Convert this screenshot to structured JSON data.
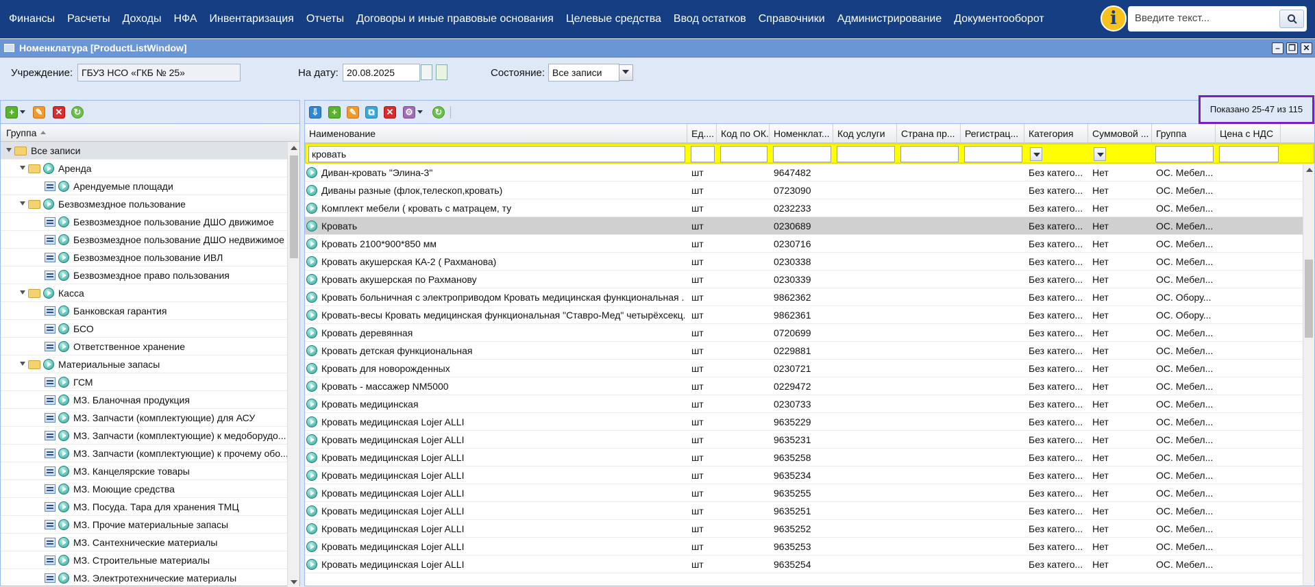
{
  "menu": [
    "Финансы",
    "Расчеты",
    "Доходы",
    "НФА",
    "Инвентаризация",
    "Отчеты",
    "Договоры и иные правовые основания",
    "Целевые средства",
    "Ввод остатков",
    "Справочники",
    "Администрирование",
    "Документооборот"
  ],
  "search": {
    "placeholder": "Введите текст..."
  },
  "window": {
    "title": "Номенклатура [ProductListWindow]"
  },
  "filters": {
    "institution_label": "Учреждение:",
    "institution_value": "ГБУЗ НСО «ГКБ № 25»",
    "date_label": "На дату:",
    "date_value": "20.08.2025",
    "state_label": "Состояние:",
    "state_value": "Все записи"
  },
  "tree": {
    "header": "Группа",
    "nodes": [
      {
        "label": "Все записи",
        "level": 0,
        "type": "folder",
        "selected": true
      },
      {
        "label": "Аренда",
        "level": 1,
        "type": "folder"
      },
      {
        "label": "Арендуемые площади",
        "level": 2,
        "type": "leaf"
      },
      {
        "label": "Безвозмездное пользование",
        "level": 1,
        "type": "folder"
      },
      {
        "label": "Безвозмездное пользование ДШО движимое",
        "level": 2,
        "type": "leaf"
      },
      {
        "label": "Безвозмездное пользование ДШО недвижимое",
        "level": 2,
        "type": "leaf"
      },
      {
        "label": "Безвозмездное пользование ИВЛ",
        "level": 2,
        "type": "leaf"
      },
      {
        "label": "Безвозмездное право пользования",
        "level": 2,
        "type": "leaf"
      },
      {
        "label": "Касса",
        "level": 1,
        "type": "folder"
      },
      {
        "label": "Банковская гарантия",
        "level": 2,
        "type": "leaf"
      },
      {
        "label": "БСО",
        "level": 2,
        "type": "leaf"
      },
      {
        "label": "Ответственное хранение",
        "level": 2,
        "type": "leaf"
      },
      {
        "label": "Материальные запасы",
        "level": 1,
        "type": "folder"
      },
      {
        "label": "ГСМ",
        "level": 2,
        "type": "leaf"
      },
      {
        "label": "МЗ. Бланочная продукция",
        "level": 2,
        "type": "leaf"
      },
      {
        "label": "МЗ. Запчасти (комплектующие) для АСУ",
        "level": 2,
        "type": "leaf"
      },
      {
        "label": "МЗ. Запчасти (комплектующие) к медоборудо...",
        "level": 2,
        "type": "leaf"
      },
      {
        "label": "МЗ. Запчасти (комплектующие) к прочему обо...",
        "level": 2,
        "type": "leaf"
      },
      {
        "label": "МЗ. Канцелярские товары",
        "level": 2,
        "type": "leaf"
      },
      {
        "label": "МЗ. Моющие средства",
        "level": 2,
        "type": "leaf"
      },
      {
        "label": "МЗ. Посуда. Тара для хранения ТМЦ",
        "level": 2,
        "type": "leaf"
      },
      {
        "label": "МЗ. Прочие материальные запасы",
        "level": 2,
        "type": "leaf"
      },
      {
        "label": "МЗ. Сантехнические материалы",
        "level": 2,
        "type": "leaf"
      },
      {
        "label": "МЗ. Строительные материалы",
        "level": 2,
        "type": "leaf"
      },
      {
        "label": "МЗ. Электротехнические материалы",
        "level": 2,
        "type": "leaf"
      }
    ]
  },
  "grid": {
    "shown": "Показано 25-47 из 115",
    "columns": [
      "Наименование",
      "Ед....",
      "Код по ОК...",
      "Номенклат...",
      "Код услуги",
      "Страна пр...",
      "Регистрац...",
      "Категория",
      "Суммовой ...",
      "Группа",
      "Цена с НДС"
    ],
    "filter_name": "кровать",
    "rows": [
      {
        "name": "Диван-кровать \"Элина-3\"",
        "unit": "шт",
        "nom": "9647482",
        "cat": "Без катего...",
        "sum": "Нет",
        "group": "ОС. Мебел..."
      },
      {
        "name": "Диваны разные (флок,телескоп,кровать)",
        "unit": "шт",
        "nom": "0723090",
        "cat": "Без катего...",
        "sum": "Нет",
        "group": "ОС. Мебел..."
      },
      {
        "name": "Комплект мебели ( кровать с матрацем, ту",
        "unit": "шт",
        "nom": "0232233",
        "cat": "Без катего...",
        "sum": "Нет",
        "group": "ОС. Мебел..."
      },
      {
        "name": "Кровать",
        "unit": "шт",
        "nom": "0230689",
        "cat": "Без катего...",
        "sum": "Нет",
        "group": "ОС. Мебел...",
        "selected": true
      },
      {
        "name": "Кровать 2100*900*850 мм",
        "unit": "шт",
        "nom": "0230716",
        "cat": "Без катего...",
        "sum": "Нет",
        "group": "ОС. Мебел..."
      },
      {
        "name": "Кровать акушерская КА-2 ( Рахманова)",
        "unit": "шт",
        "nom": "0230338",
        "cat": "Без катего...",
        "sum": "Нет",
        "group": "ОС. Мебел..."
      },
      {
        "name": "Кровать акушерская по Рахманову",
        "unit": "шт",
        "nom": "0230339",
        "cat": "Без катего...",
        "sum": "Нет",
        "group": "ОС. Мебел..."
      },
      {
        "name": "Кровать больничная с электроприводом Кровать медицинская функциональная ...",
        "unit": "шт",
        "nom": "9862362",
        "cat": "Без катего...",
        "sum": "Нет",
        "group": "ОС. Обору..."
      },
      {
        "name": "Кровать-весы Кровать медицинская функциональная \"Ставро-Мед\" четырёхсекц...",
        "unit": "шт",
        "nom": "9862361",
        "cat": "Без катего...",
        "sum": "Нет",
        "group": "ОС. Обору..."
      },
      {
        "name": "Кровать деревянная",
        "unit": "шт",
        "nom": "0720699",
        "cat": "Без катего...",
        "sum": "Нет",
        "group": "ОС. Мебел..."
      },
      {
        "name": "Кровать детская функциональная",
        "unit": "шт",
        "nom": "0229881",
        "cat": "Без катего...",
        "sum": "Нет",
        "group": "ОС. Мебел..."
      },
      {
        "name": "Кровать для новорожденных",
        "unit": "шт",
        "nom": "0230721",
        "cat": "Без катего...",
        "sum": "Нет",
        "group": "ОС. Мебел..."
      },
      {
        "name": "Кровать - массажер NM5000",
        "unit": "шт",
        "nom": "0229472",
        "cat": "Без катего...",
        "sum": "Нет",
        "group": "ОС. Мебел..."
      },
      {
        "name": "Кровать медицинская",
        "unit": "шт",
        "nom": "0230733",
        "cat": "Без катего...",
        "sum": "Нет",
        "group": "ОС. Мебел..."
      },
      {
        "name": "Кровать медицинская Lojer ALLI",
        "unit": "шт",
        "nom": "9635229",
        "cat": "Без катего...",
        "sum": "Нет",
        "group": "ОС. Мебел..."
      },
      {
        "name": "Кровать медицинская Lojer ALLI",
        "unit": "шт",
        "nom": "9635231",
        "cat": "Без катего...",
        "sum": "Нет",
        "group": "ОС. Мебел..."
      },
      {
        "name": "Кровать медицинская Lojer ALLI",
        "unit": "шт",
        "nom": "9635258",
        "cat": "Без катего...",
        "sum": "Нет",
        "group": "ОС. Мебел..."
      },
      {
        "name": "Кровать медицинская Lojer ALLI",
        "unit": "шт",
        "nom": "9635234",
        "cat": "Без катего...",
        "sum": "Нет",
        "group": "ОС. Мебел..."
      },
      {
        "name": "Кровать медицинская Lojer ALLI",
        "unit": "шт",
        "nom": "9635255",
        "cat": "Без катего...",
        "sum": "Нет",
        "group": "ОС. Мебел..."
      },
      {
        "name": "Кровать медицинская Lojer ALLI",
        "unit": "шт",
        "nom": "9635251",
        "cat": "Без катего...",
        "sum": "Нет",
        "group": "ОС. Мебел..."
      },
      {
        "name": "Кровать медицинская Lojer ALLI",
        "unit": "шт",
        "nom": "9635252",
        "cat": "Без катего...",
        "sum": "Нет",
        "group": "ОС. Мебел..."
      },
      {
        "name": "Кровать медицинская Lojer ALLI",
        "unit": "шт",
        "nom": "9635253",
        "cat": "Без катего...",
        "sum": "Нет",
        "group": "ОС. Мебел..."
      },
      {
        "name": "Кровать медицинская Lojer ALLI",
        "unit": "шт",
        "nom": "9635254",
        "cat": "Без катего...",
        "sum": "Нет",
        "group": "ОС. Мебел..."
      }
    ]
  },
  "colors": {
    "topbar": "#163e82",
    "titlebar": "#6b96d5",
    "filter_highlight": "#ffff00",
    "shown_border": "#7a1fbf"
  },
  "icons": {
    "info": "info-icon",
    "search": "search-icon",
    "add": "plus-icon",
    "edit": "edit-icon",
    "delete": "delete-icon",
    "refresh": "refresh-icon",
    "folder": "folder-icon",
    "leaf": "list-icon",
    "open": "open-record-icon"
  }
}
